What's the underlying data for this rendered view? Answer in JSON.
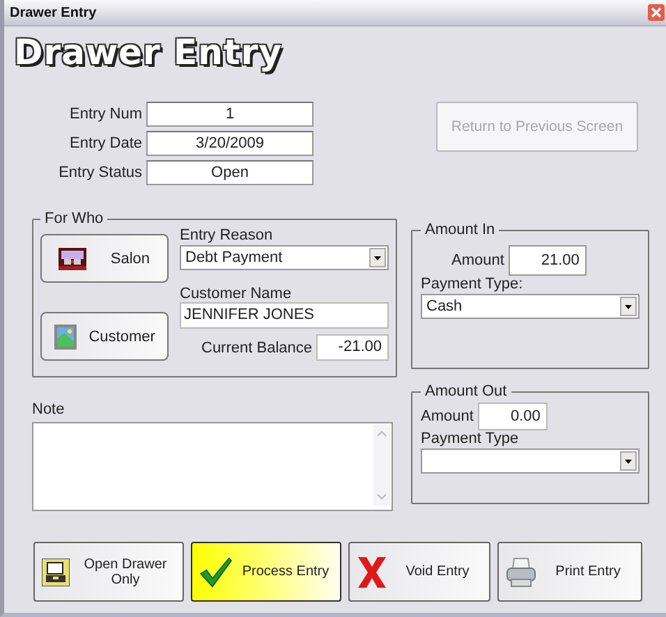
{
  "window": {
    "title": "Drawer Entry",
    "heading": "Drawer Entry"
  },
  "entry_fields": [
    {
      "label": "Entry Num",
      "value": "1"
    },
    {
      "label": "Entry Date",
      "value": "3/20/2009"
    },
    {
      "label": "Entry Status",
      "value": "Open"
    }
  ],
  "return_button": {
    "label": "Return to Previous Screen",
    "disabled": true
  },
  "for_who": {
    "title": "For Who",
    "buttons": [
      {
        "label": "Salon"
      },
      {
        "label": "Customer"
      }
    ],
    "entry_reason": {
      "label": "Entry Reason",
      "value": "Debt Payment"
    },
    "customer_name": {
      "label": "Customer Name",
      "value": "JENNIFER JONES"
    },
    "current_balance": {
      "label": "Current Balance",
      "value": "-21.00"
    }
  },
  "amount_in": {
    "title": "Amount In",
    "amount_label": "Amount",
    "amount": "21.00",
    "payment_type_label": "Payment Type:",
    "payment_type": "Cash"
  },
  "amount_out": {
    "title": "Amount Out",
    "amount_label": "Amount",
    "amount": "0.00",
    "payment_type_label": "Payment Type"
  },
  "note": {
    "label": "Note"
  },
  "actions": [
    {
      "label": "Open Drawer Only",
      "default": false
    },
    {
      "label": "Process Entry",
      "default": true
    },
    {
      "label": "Void Entry",
      "default": false
    },
    {
      "label": "Print Entry",
      "default": false
    }
  ]
}
